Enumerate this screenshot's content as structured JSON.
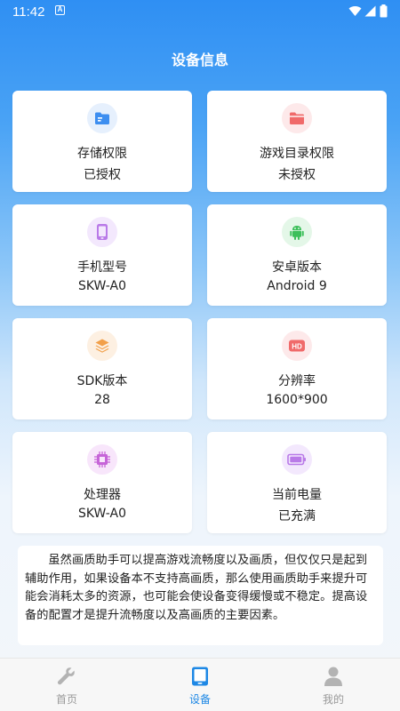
{
  "status_bar": {
    "time": "11:42",
    "notification_icon": "a-box-icon",
    "icons": [
      "wifi-icon",
      "signal-icon",
      "battery-icon"
    ]
  },
  "header": {
    "title": "设备信息"
  },
  "cards": [
    {
      "title": "存储权限",
      "value": "已授权",
      "icon": "folder-icon",
      "icon_color": "#3d8ef0",
      "icon_bg": "#e6f0fd"
    },
    {
      "title": "游戏目录权限",
      "value": "未授权",
      "icon": "folder-icon",
      "icon_color": "#f06a6a",
      "icon_bg": "#fde9ea"
    },
    {
      "title": "手机型号",
      "value": "SKW-A0",
      "icon": "phone-icon",
      "icon_color": "#b97ae8",
      "icon_bg": "#f3e8fd"
    },
    {
      "title": "安卓版本",
      "value": "Android 9",
      "icon": "android-icon",
      "icon_color": "#3cbf5a",
      "icon_bg": "#e4f7e8"
    },
    {
      "title": "SDK版本",
      "value": "28",
      "icon": "layers-icon",
      "icon_color": "#f2a04a",
      "icon_bg": "#fdf0e2"
    },
    {
      "title": "分辨率",
      "value": "1600*900",
      "icon": "hd-icon",
      "icon_color": "#f06a6a",
      "icon_bg": "#fde9ea"
    },
    {
      "title": "处理器",
      "value": "SKW-A0",
      "icon": "chip-icon",
      "icon_color": "#c664d8",
      "icon_bg": "#f8e6fb"
    },
    {
      "title": "当前电量",
      "value": "已充满",
      "icon": "battery-icon",
      "icon_color": "#b97ae8",
      "icon_bg": "#f3e8fd"
    }
  ],
  "notice": {
    "text": "虽然画质助手可以提高游戏流畅度以及画质，但仅仅只是起到辅助作用，如果设备本不支持高画质，那么使用画质助手来提升可能会消耗太多的资源，也可能会使设备变得缓慢或不稳定。提高设备的配置才是提升流畅度以及高画质的主要因素。"
  },
  "bottom_nav": [
    {
      "label": "首页",
      "icon": "wrench-icon",
      "active": false
    },
    {
      "label": "设备",
      "icon": "tablet-icon",
      "active": true
    },
    {
      "label": "我的",
      "icon": "user-icon",
      "active": false
    }
  ],
  "colors": {
    "accent": "#1e88e5",
    "nav_inactive": "#999999",
    "header_bg": "#2f8ff3"
  }
}
